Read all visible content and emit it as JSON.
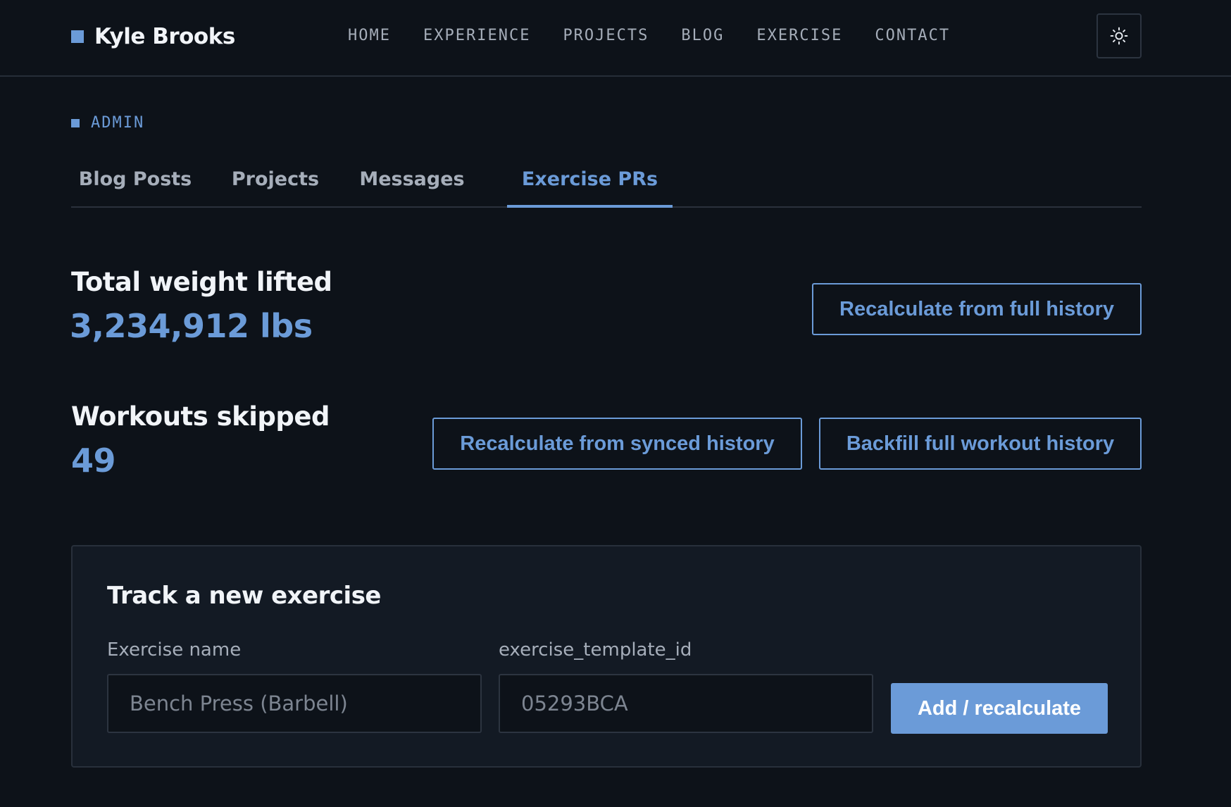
{
  "header": {
    "brand": "Kyle Brooks",
    "nav": [
      "HOME",
      "EXPERIENCE",
      "PROJECTS",
      "BLOG",
      "EXERCISE",
      "CONTACT"
    ],
    "theme_toggle_icon": "sun-icon"
  },
  "section_label": "ADMIN",
  "tabs": [
    {
      "label": "Blog Posts",
      "active": false
    },
    {
      "label": "Projects",
      "active": false
    },
    {
      "label": "Messages",
      "active": false
    },
    {
      "label": "Exercise PRs",
      "active": true
    }
  ],
  "stats": {
    "total_weight": {
      "title": "Total weight lifted",
      "value": "3,234,912 lbs",
      "button": "Recalculate from full history"
    },
    "workouts_skipped": {
      "title": "Workouts skipped",
      "value": "49",
      "buttons": [
        "Recalculate from synced history",
        "Backfill full workout history"
      ]
    }
  },
  "track_form": {
    "title": "Track a new exercise",
    "name_label": "Exercise name",
    "name_placeholder": "Bench Press (Barbell)",
    "name_value": "",
    "id_label": "exercise_template_id",
    "id_placeholder": "05293BCA",
    "id_value": "",
    "submit_label": "Add / recalculate"
  },
  "colors": {
    "background": "#0d1219",
    "accent": "#6b9bd8",
    "card": "#131a24",
    "muted_text": "#a6aeba"
  }
}
